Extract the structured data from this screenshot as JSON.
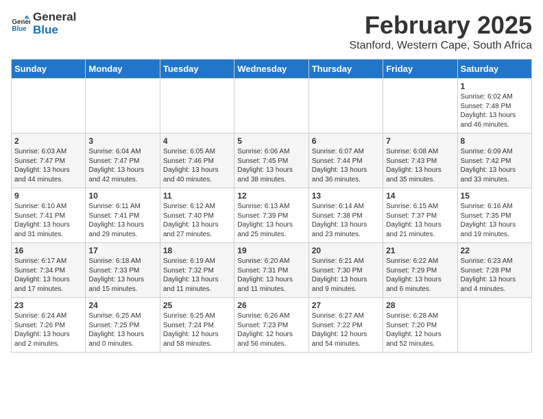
{
  "logo": {
    "general": "General",
    "blue": "Blue"
  },
  "title": "February 2025",
  "subtitle": "Stanford, Western Cape, South Africa",
  "headers": [
    "Sunday",
    "Monday",
    "Tuesday",
    "Wednesday",
    "Thursday",
    "Friday",
    "Saturday"
  ],
  "weeks": [
    [
      {
        "day": "",
        "info": ""
      },
      {
        "day": "",
        "info": ""
      },
      {
        "day": "",
        "info": ""
      },
      {
        "day": "",
        "info": ""
      },
      {
        "day": "",
        "info": ""
      },
      {
        "day": "",
        "info": ""
      },
      {
        "day": "1",
        "info": "Sunrise: 6:02 AM\nSunset: 7:48 PM\nDaylight: 13 hours\nand 46 minutes."
      }
    ],
    [
      {
        "day": "2",
        "info": "Sunrise: 6:03 AM\nSunset: 7:47 PM\nDaylight: 13 hours\nand 44 minutes."
      },
      {
        "day": "3",
        "info": "Sunrise: 6:04 AM\nSunset: 7:47 PM\nDaylight: 13 hours\nand 42 minutes."
      },
      {
        "day": "4",
        "info": "Sunrise: 6:05 AM\nSunset: 7:46 PM\nDaylight: 13 hours\nand 40 minutes."
      },
      {
        "day": "5",
        "info": "Sunrise: 6:06 AM\nSunset: 7:45 PM\nDaylight: 13 hours\nand 38 minutes."
      },
      {
        "day": "6",
        "info": "Sunrise: 6:07 AM\nSunset: 7:44 PM\nDaylight: 13 hours\nand 36 minutes."
      },
      {
        "day": "7",
        "info": "Sunrise: 6:08 AM\nSunset: 7:43 PM\nDaylight: 13 hours\nand 35 minutes."
      },
      {
        "day": "8",
        "info": "Sunrise: 6:09 AM\nSunset: 7:42 PM\nDaylight: 13 hours\nand 33 minutes."
      }
    ],
    [
      {
        "day": "9",
        "info": "Sunrise: 6:10 AM\nSunset: 7:41 PM\nDaylight: 13 hours\nand 31 minutes."
      },
      {
        "day": "10",
        "info": "Sunrise: 6:11 AM\nSunset: 7:41 PM\nDaylight: 13 hours\nand 29 minutes."
      },
      {
        "day": "11",
        "info": "Sunrise: 6:12 AM\nSunset: 7:40 PM\nDaylight: 13 hours\nand 27 minutes."
      },
      {
        "day": "12",
        "info": "Sunrise: 6:13 AM\nSunset: 7:39 PM\nDaylight: 13 hours\nand 25 minutes."
      },
      {
        "day": "13",
        "info": "Sunrise: 6:14 AM\nSunset: 7:38 PM\nDaylight: 13 hours\nand 23 minutes."
      },
      {
        "day": "14",
        "info": "Sunrise: 6:15 AM\nSunset: 7:37 PM\nDaylight: 13 hours\nand 21 minutes."
      },
      {
        "day": "15",
        "info": "Sunrise: 6:16 AM\nSunset: 7:35 PM\nDaylight: 13 hours\nand 19 minutes."
      }
    ],
    [
      {
        "day": "16",
        "info": "Sunrise: 6:17 AM\nSunset: 7:34 PM\nDaylight: 13 hours\nand 17 minutes."
      },
      {
        "day": "17",
        "info": "Sunrise: 6:18 AM\nSunset: 7:33 PM\nDaylight: 13 hours\nand 15 minutes."
      },
      {
        "day": "18",
        "info": "Sunrise: 6:19 AM\nSunset: 7:32 PM\nDaylight: 13 hours\nand 11 minutes."
      },
      {
        "day": "19",
        "info": "Sunrise: 6:20 AM\nSunset: 7:31 PM\nDaylight: 13 hours\nand 11 minutes."
      },
      {
        "day": "20",
        "info": "Sunrise: 6:21 AM\nSunset: 7:30 PM\nDaylight: 13 hours\nand 9 minutes."
      },
      {
        "day": "21",
        "info": "Sunrise: 6:22 AM\nSunset: 7:29 PM\nDaylight: 13 hours\nand 6 minutes."
      },
      {
        "day": "22",
        "info": "Sunrise: 6:23 AM\nSunset: 7:28 PM\nDaylight: 13 hours\nand 4 minutes."
      }
    ],
    [
      {
        "day": "23",
        "info": "Sunrise: 6:24 AM\nSunset: 7:26 PM\nDaylight: 13 hours\nand 2 minutes."
      },
      {
        "day": "24",
        "info": "Sunrise: 6:25 AM\nSunset: 7:25 PM\nDaylight: 13 hours\nand 0 minutes."
      },
      {
        "day": "25",
        "info": "Sunrise: 6:25 AM\nSunset: 7:24 PM\nDaylight: 12 hours\nand 58 minutes."
      },
      {
        "day": "26",
        "info": "Sunrise: 6:26 AM\nSunset: 7:23 PM\nDaylight: 12 hours\nand 56 minutes."
      },
      {
        "day": "27",
        "info": "Sunrise: 6:27 AM\nSunset: 7:22 PM\nDaylight: 12 hours\nand 54 minutes."
      },
      {
        "day": "28",
        "info": "Sunrise: 6:28 AM\nSunset: 7:20 PM\nDaylight: 12 hours\nand 52 minutes."
      },
      {
        "day": "",
        "info": ""
      }
    ]
  ]
}
